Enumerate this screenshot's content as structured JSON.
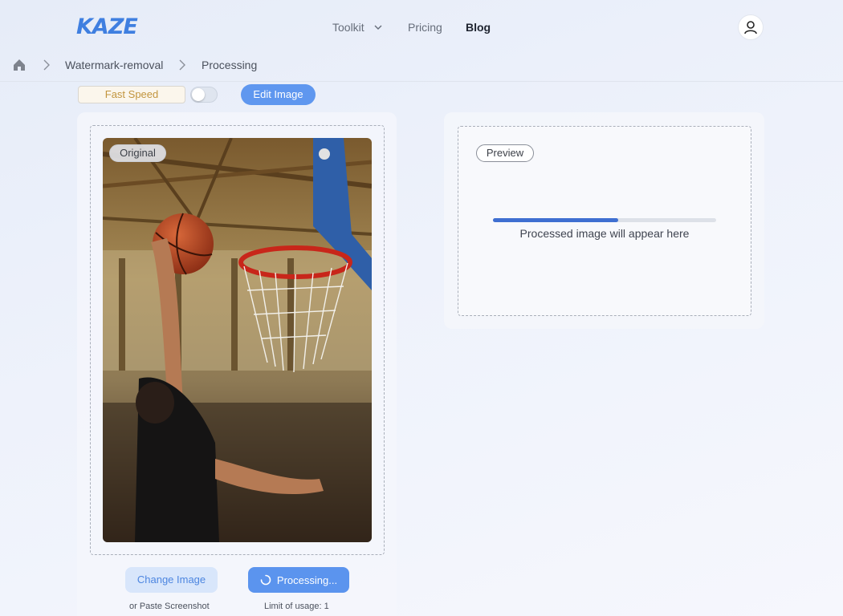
{
  "header": {
    "logo_text": "KAZE",
    "nav": {
      "toolkit_label": "Toolkit",
      "pricing_label": "Pricing",
      "blog_label": "Blog"
    },
    "user_icon": "user-icon"
  },
  "breadcrumb": {
    "items": [
      "Watermark-removal",
      "Processing"
    ]
  },
  "toolbar": {
    "fast_speed_label": "Fast Speed",
    "fast_speed_enabled": false,
    "edit_image_label": "Edit Image"
  },
  "original_panel": {
    "badge": "Original",
    "image_description_icon": "basketball-dunk-photo",
    "change_image_label": "Change Image",
    "processing_label": "Processing...",
    "paste_hint": "or Paste Screenshot",
    "usage_limit": "Limit of usage: 1"
  },
  "preview_panel": {
    "badge": "Preview",
    "progress": 0.56,
    "placeholder": "Processed image will appear here"
  },
  "colors": {
    "accent": "#5b94ee",
    "logo": "#3f7fe0",
    "progress": "#3f6fd1",
    "fast_speed_text": "#c2953e"
  }
}
